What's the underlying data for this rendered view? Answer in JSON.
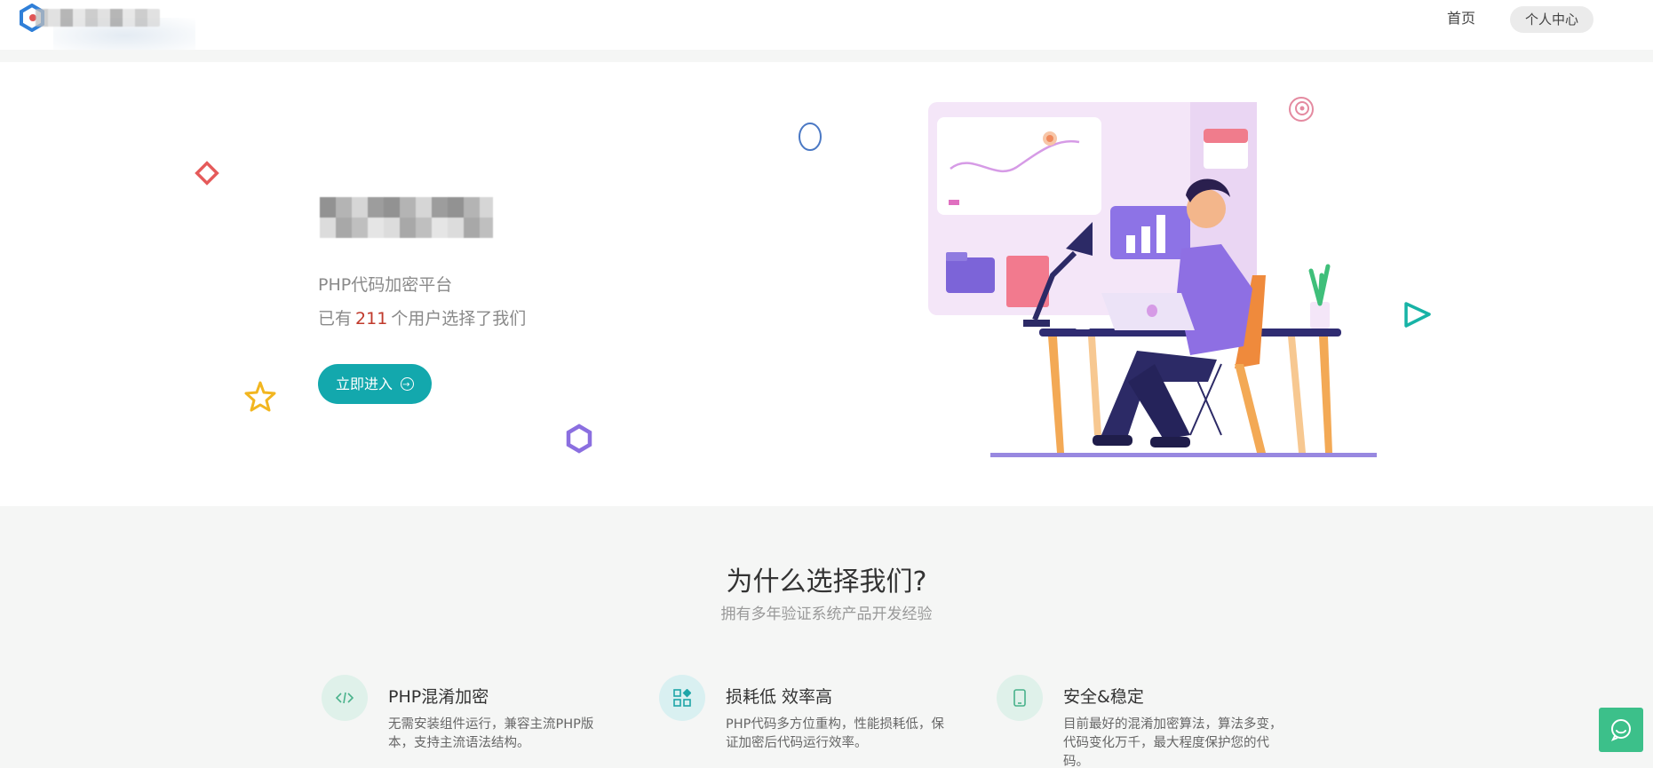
{
  "header": {
    "nav": [
      {
        "label": "首页"
      },
      {
        "label": "个人中心"
      }
    ]
  },
  "hero": {
    "subtitle": "PHP代码加密平台",
    "count_prefix": "已有",
    "count": "211",
    "count_suffix": "个用户选择了我们",
    "cta_label": "立即进入"
  },
  "features": {
    "title": "为什么选择我们?",
    "subtitle": "拥有多年验证系统产品开发经验",
    "items": [
      {
        "icon": "code-icon",
        "title": "PHP混淆加密",
        "desc": "无需安装组件运行，兼容主流PHP版本，支持主流语法结构。",
        "icon_bg": "#dff1ea",
        "icon_color": "#49b28b"
      },
      {
        "icon": "grid-icon",
        "title": "损耗低 效率高",
        "desc": "PHP代码多方位重构，性能损耗低，保证加密后代码运行效率。",
        "icon_bg": "#d9f0f1",
        "icon_color": "#1ea5a8"
      },
      {
        "icon": "tablet-icon",
        "title": "安全&稳定",
        "desc": "目前最好的混淆加密算法，算法多变，代码变化万千，最大程度保护您的代码。",
        "icon_bg": "#dff1ea",
        "icon_color": "#49b28b"
      }
    ]
  },
  "colors": {
    "accent": "#13a8ad",
    "count_red": "#c0392b",
    "chat_green": "#3cc08a"
  }
}
